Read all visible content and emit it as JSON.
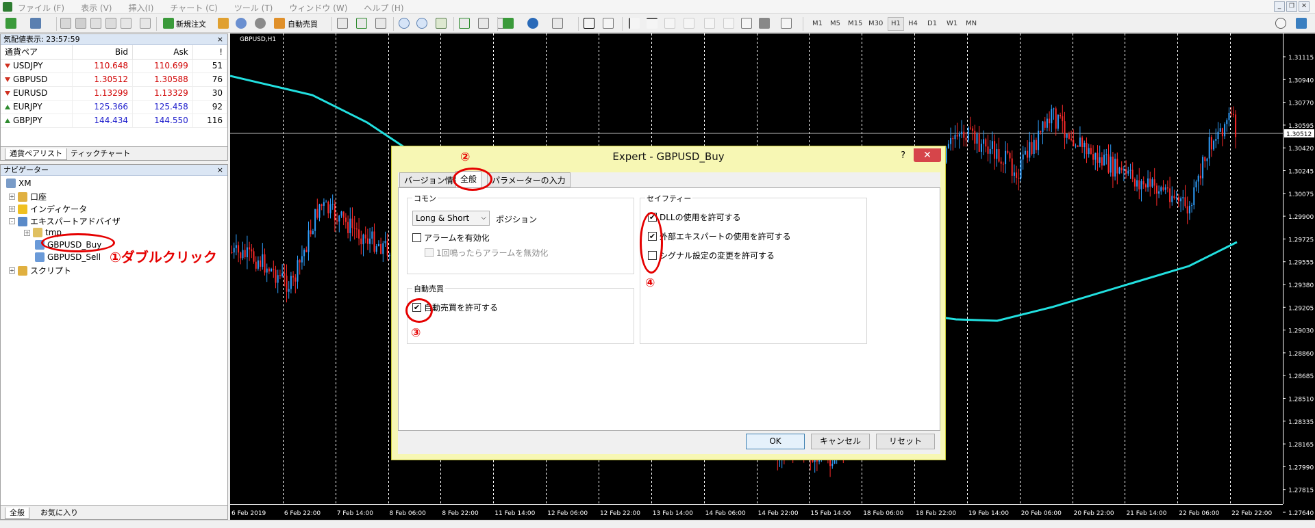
{
  "menu": {
    "items": [
      "ファイル (F)",
      "表示 (V)",
      "挿入(I)",
      "チャート (C)",
      "ツール (T)",
      "ウィンドウ (W)",
      "ヘルプ (H)"
    ],
    "window_controls": [
      "_",
      "❐",
      "✕"
    ]
  },
  "toolbar": {
    "new_order": "新規注文",
    "auto_trade": "自動売買",
    "timeframes": [
      "M1",
      "M5",
      "M15",
      "M30",
      "H1",
      "H4",
      "D1",
      "W1",
      "MN"
    ],
    "active_timeframe": "H1"
  },
  "market_watch": {
    "title": "気配値表示: 23:57:59",
    "close": "×",
    "headers": [
      "通貨ペア",
      "Bid",
      "Ask",
      "!"
    ],
    "rows": [
      {
        "symbol": "USDJPY",
        "bid": "110.648",
        "ask": "110.699",
        "spread": "51",
        "dir": "down",
        "color": "#d00000"
      },
      {
        "symbol": "GBPUSD",
        "bid": "1.30512",
        "ask": "1.30588",
        "spread": "76",
        "dir": "down",
        "color": "#d00000"
      },
      {
        "symbol": "EURUSD",
        "bid": "1.13299",
        "ask": "1.13329",
        "spread": "30",
        "dir": "down",
        "color": "#d00000"
      },
      {
        "symbol": "EURJPY",
        "bid": "125.366",
        "ask": "125.458",
        "spread": "92",
        "dir": "up",
        "color": "#1c1ccc"
      },
      {
        "symbol": "GBPJPY",
        "bid": "144.434",
        "ask": "144.550",
        "spread": "116",
        "dir": "up",
        "color": "#1c1ccc"
      }
    ],
    "tabs": [
      "通貨ペアリスト",
      "ティックチャート"
    ]
  },
  "navigator": {
    "title": "ナビゲーター",
    "close": "×",
    "items": {
      "root": "XM",
      "account": "口座",
      "indicators": "インディケータ",
      "experts": "エキスパートアドバイザ",
      "tmp": "tmp",
      "buy": "GBPUSD_Buy",
      "sell": "GBPUSD_Sell",
      "scripts": "スクリプト"
    },
    "expander_plus": "+",
    "expander_minus": "-",
    "tabs": [
      "全般",
      "お気に入り"
    ]
  },
  "annotations": {
    "step1": "①ダブルクリック",
    "step2": "②",
    "step3": "③",
    "step4": "④"
  },
  "chart": {
    "title": "GBPUSD,H1",
    "current_price": "1.30512",
    "price_labels": [
      "1.31115",
      "1.30940",
      "1.30770",
      "1.30595",
      "1.30420",
      "1.30245",
      "1.30075",
      "1.29900",
      "1.29725",
      "1.29555",
      "1.29380",
      "1.29205",
      "1.29030",
      "1.28860",
      "1.28685",
      "1.28510",
      "1.28335",
      "1.28165",
      "1.27990",
      "1.27815",
      "1.27640"
    ],
    "time_labels": [
      "6 Feb 2019",
      "6 Feb 22:00",
      "7 Feb 14:00",
      "8 Feb 06:00",
      "8 Feb 22:00",
      "11 Feb 14:00",
      "12 Feb 06:00",
      "12 Feb 22:00",
      "13 Feb 14:00",
      "14 Feb 06:00",
      "14 Feb 22:00",
      "15 Feb 14:00",
      "18 Feb 06:00",
      "18 Feb 22:00",
      "19 Feb 14:00",
      "20 Feb 06:00",
      "20 Feb 22:00",
      "21 Feb 14:00",
      "22 Feb 06:00",
      "22 Feb 22:00"
    ],
    "colors": {
      "bull": "#2fa0ff",
      "bear": "#ff2a2a",
      "ma": "#22e0e0",
      "grid": "#ffffff"
    }
  },
  "dialog": {
    "title": "Expert - GBPUSD_Buy",
    "help": "?",
    "close": "✕",
    "tabs": [
      "バージョン情報",
      "全般",
      "パラメーターの入力"
    ],
    "active_tab": "全般",
    "common": {
      "label": "コモン",
      "position_value": "Long & Short",
      "position_label": "ポジション",
      "alarm_enable": "アラームを有効化",
      "alarm_once": "1回鳴ったらアラームを無効化"
    },
    "auto": {
      "label": "自動売買",
      "allow": "自動売買を許可する"
    },
    "safety": {
      "label": "セイフティー",
      "dll": "DLLの使用を許可する",
      "external": "外部エキスパートの使用を許可する",
      "signal": "シグナル設定の変更を許可する"
    },
    "check": "✔",
    "buttons": {
      "ok": "OK",
      "cancel": "キャンセル",
      "reset": "リセット"
    }
  }
}
